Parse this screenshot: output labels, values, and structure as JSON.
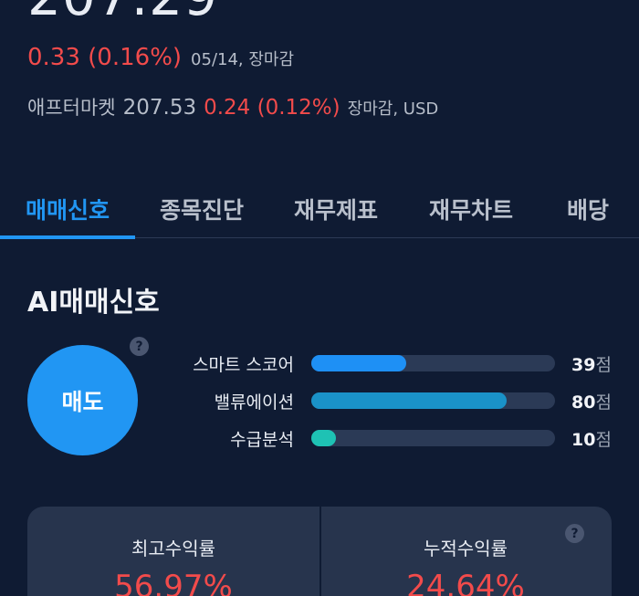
{
  "quote": {
    "price": "207.29",
    "change": "0.33 (0.16%)",
    "change_meta": "05/14, 장마감",
    "after_label": "애프터마켓",
    "after_price": "207.53",
    "after_change": "0.24 (0.12%)",
    "after_meta": "장마감, USD"
  },
  "tabs": [
    "매매신호",
    "종목진단",
    "재무제표",
    "재무차트",
    "배당"
  ],
  "signal": {
    "title": "AI매매신호",
    "verdict": "매도",
    "help_glyph": "?",
    "scores": [
      {
        "label": "스마트 스코어",
        "value": "39",
        "unit": "점",
        "fraction": 0.39,
        "color": "#1e90f5"
      },
      {
        "label": "밸류에이션",
        "value": "80",
        "unit": "점",
        "fraction": 0.8,
        "color": "#1a92c8"
      },
      {
        "label": "수급분석",
        "value": "10",
        "unit": "점",
        "fraction": 0.1,
        "color": "#1ec2b4"
      }
    ]
  },
  "returns": {
    "max_label": "최고수익률",
    "max_value": "56.97%",
    "cum_label": "누적수익률",
    "cum_value": "24.64%"
  },
  "colors": {
    "background": "#0f1b33",
    "accent": "#2196f3",
    "up": "#f24b4b"
  }
}
